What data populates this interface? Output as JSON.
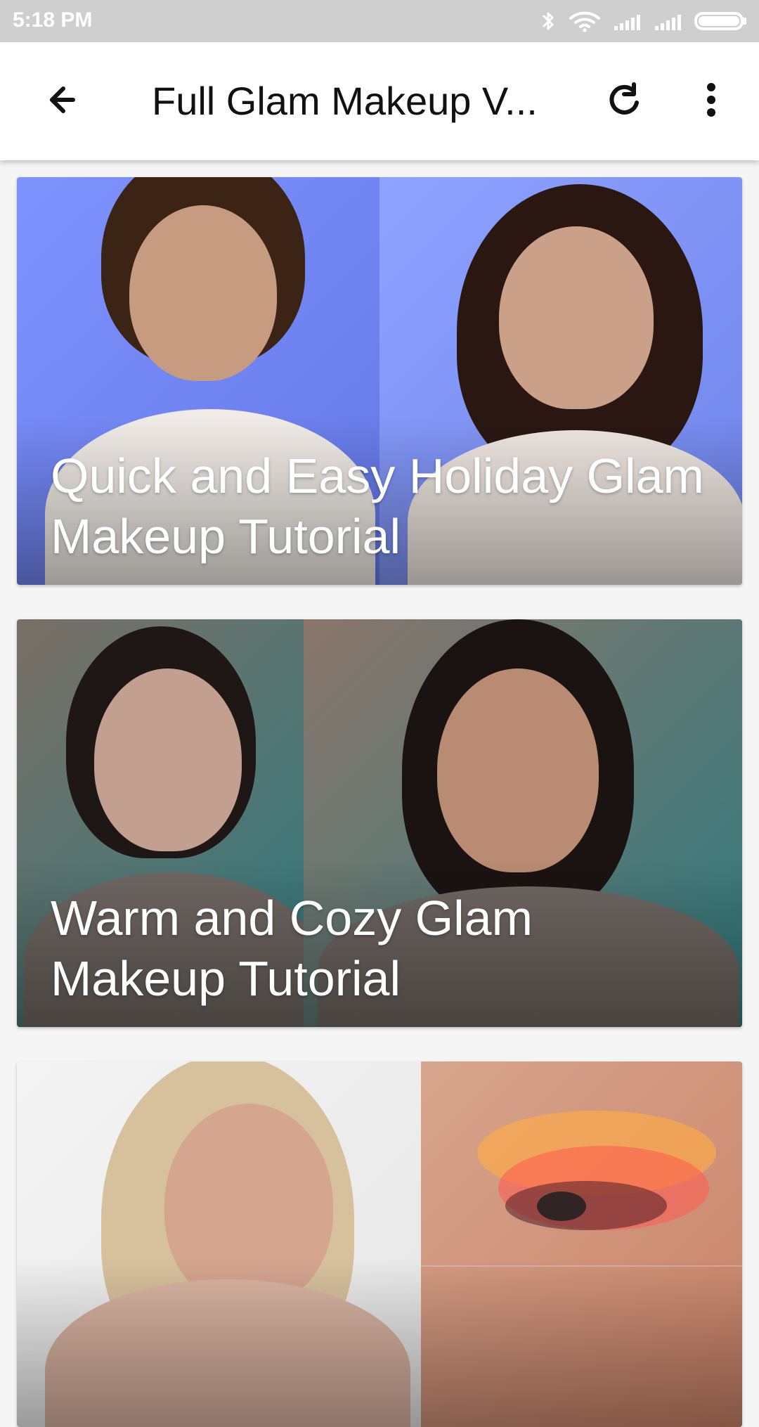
{
  "status_bar": {
    "time": "5:18 PM",
    "icons": [
      "bluetooth-icon",
      "wifi-icon",
      "signal-icon",
      "signal-icon",
      "battery-icon"
    ]
  },
  "app_bar": {
    "title": "Full Glam Makeup V...",
    "left_icon": "arrow-left-icon",
    "right_icons": [
      "refresh-icon",
      "more-vert-icon"
    ]
  },
  "list": {
    "items": [
      {
        "title": "Quick and Easy Holiday Glam Makeup Tutorial"
      },
      {
        "title": "Warm and Cozy Glam Makeup Tutorial"
      },
      {
        "title": ""
      }
    ]
  },
  "colors": {
    "status_bar_bg": "#cfcfcf",
    "app_bar_bg": "#ffffff",
    "page_bg": "#f5f5f5",
    "text_primary": "#111111"
  }
}
